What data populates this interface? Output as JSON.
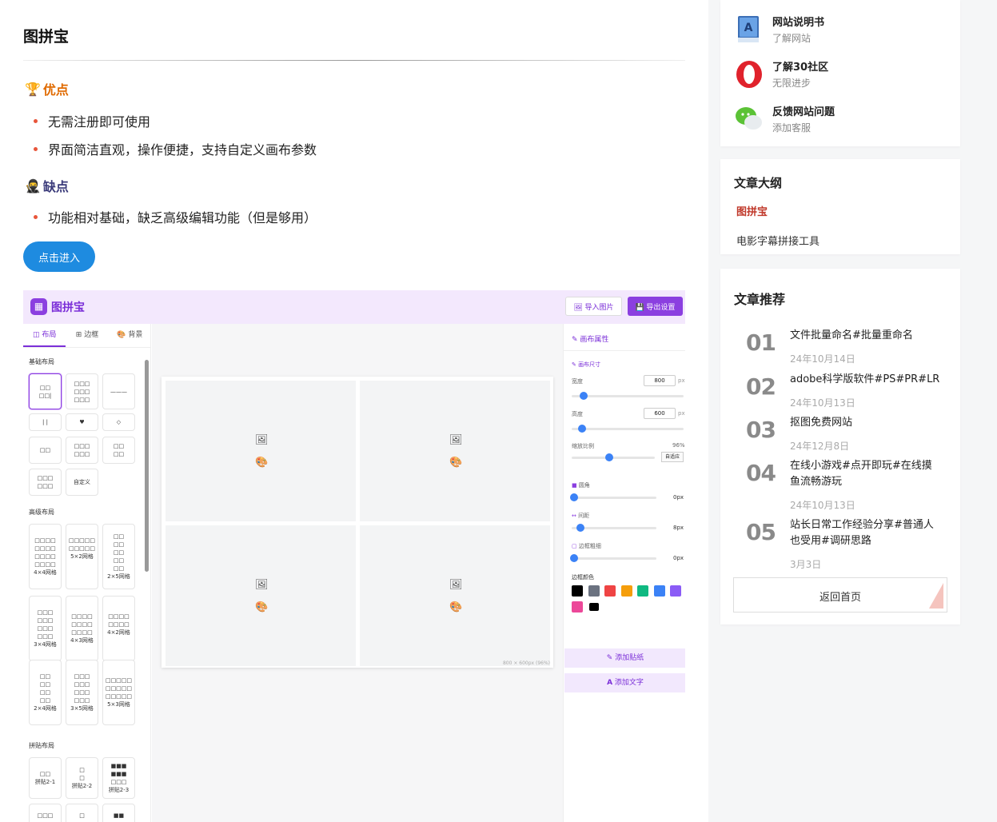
{
  "article": {
    "title": "图拼宝",
    "pros_title": "优点",
    "pros": [
      "无需注册即可使用",
      "界面简洁直观，操作便捷，支持自定义画布参数"
    ],
    "cons_title": "缺点",
    "cons": [
      "功能相对基础，缺乏高级编辑功能（但是够用）"
    ],
    "enter_button": "点击进入"
  },
  "app": {
    "name": "图拼宝",
    "logo_icon": "grid-icon",
    "import_button": "导入图片",
    "export_button": "导出设置",
    "tabs": [
      "布局",
      "边框",
      "背景"
    ],
    "groups": {
      "basic": "基础布局",
      "advanced": "高级布局",
      "collage": "拼贴布局"
    },
    "tiles": {
      "custom": "自定义",
      "g44": "4×4网格",
      "g52": "5×2网格",
      "g25": "2×5网格",
      "g34": "3×4网格",
      "g43": "4×3网格",
      "g42": "4×2网格",
      "g24": "2×4网格",
      "g35": "3×5网格",
      "g53": "5×3网格",
      "c21": "拼贴2-1",
      "c22": "拼贴2-2",
      "c23": "拼贴2-3"
    },
    "canvas_dims": "800 × 600px (96%)",
    "right": {
      "title": "画布属性",
      "size_label": "画布尺寸",
      "width_label": "宽度",
      "width_value": "800",
      "unit": "px",
      "height_label": "高度",
      "height_value": "600",
      "scale_label": "缩放比例",
      "scale_value": "96%",
      "fit_button": "自适应",
      "radius_label": "圆角",
      "radius_value": "0px",
      "gap_label": "间距",
      "gap_value": "8px",
      "border_label": "边框粗细",
      "border_value": "0px",
      "color_label": "边框颜色",
      "colors": [
        "#000000",
        "#6b7280",
        "#ef4444",
        "#f59e0b",
        "#10b981",
        "#3b82f6",
        "#8b5cf6",
        "#ec4899",
        "#000000"
      ],
      "add_sticker": "添加贴纸",
      "add_text": "添加文字"
    }
  },
  "sidebar": {
    "links": [
      {
        "title": "网站说明书",
        "sub": "了解网站",
        "icon": "book-icon"
      },
      {
        "title": "了解30社区",
        "sub": "无限进步",
        "icon": "opera-icon"
      },
      {
        "title": "反馈网站问题",
        "sub": "添加客服",
        "icon": "wechat-icon"
      }
    ],
    "toc": {
      "title": "文章大纲",
      "items": [
        "图拼宝",
        "电影字幕拼接工具"
      ]
    },
    "recommend": {
      "title": "文章推荐",
      "items": [
        {
          "num": "01",
          "title": "文件批量命名#批量重命名",
          "date": "24年10月14日"
        },
        {
          "num": "02",
          "title": "adobe科学版软件#PS#PR#LR",
          "date": "24年10月13日"
        },
        {
          "num": "03",
          "title": "抠图免费网站",
          "date": "24年12月8日"
        },
        {
          "num": "04",
          "title": "在线小游戏#点开即玩#在线摸鱼流畅游玩",
          "date": "24年10月13日"
        },
        {
          "num": "05",
          "title": "站长日常工作经验分享#普通人也受用#调研思路",
          "date": "3月3日"
        }
      ],
      "home_button": "返回首页"
    }
  }
}
